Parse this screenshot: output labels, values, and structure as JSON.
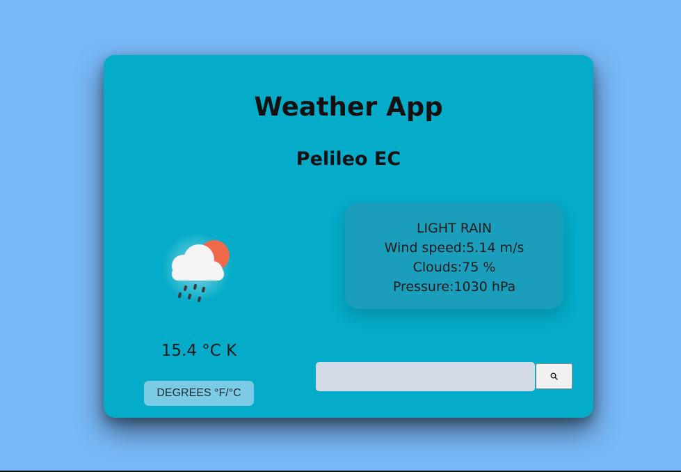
{
  "header": {
    "title": "Weather App",
    "location": "Pelileo EC"
  },
  "current": {
    "temperature": "15.4 °C K",
    "icon": "cloud-sun-rain-icon",
    "toggle_label": "DEGREES °F/°C"
  },
  "details": {
    "description": "LIGHT RAIN",
    "wind": "Wind speed:5.14 m/s",
    "clouds": "Clouds:75 %",
    "pressure": "Pressure:1030 hPa"
  },
  "search": {
    "value": "",
    "placeholder": "",
    "button_icon": "search-icon"
  },
  "colors": {
    "page_background": "#78b8f7",
    "card_background": "#05acc9",
    "details_background": "#1a9ebc",
    "sun": "#f0694a"
  }
}
